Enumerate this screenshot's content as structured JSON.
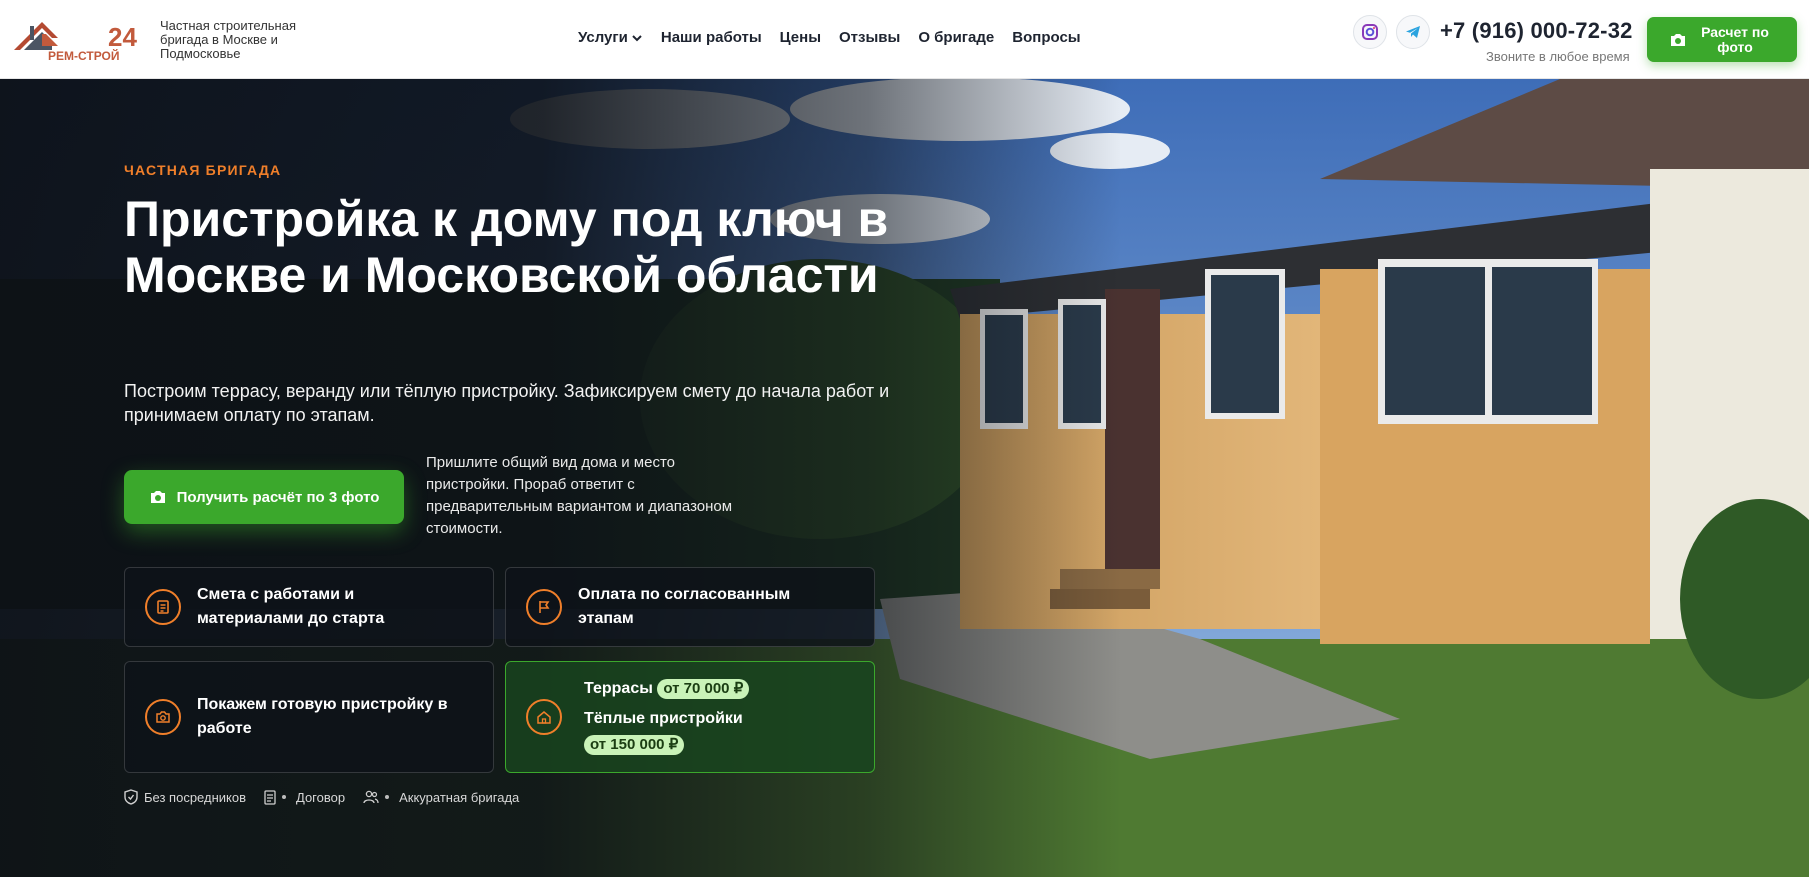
{
  "header": {
    "logo_text": "24 РЕМ-СТРОЙ",
    "tagline": "Частная строительная бригада в Москве и Подмосковье",
    "nav": [
      "Услуги",
      "Наши работы",
      "Цены",
      "Отзывы",
      "О бригаде",
      "Вопросы"
    ],
    "phone": "+7 (916) 000-72-32",
    "phone_note": "Звоните в любое время",
    "button_label": "Расчет по фото",
    "icons": [
      "instagram-icon",
      "telegram-icon",
      "camera-icon"
    ]
  },
  "hero": {
    "eyebrow": "ЧАСТНАЯ БРИГАДА",
    "title": "Пристройка к дому под ключ в Москве и Московской области",
    "subtitle": "Построим террасу, веранду или тёплую пристройку. Зафиксируем смету до начала работ и принимаем оплату по этапам.",
    "cta_label": "Получить расчёт по 3 фото",
    "cta_note": "Пришлите общий вид дома и место пристройки. Прораб ответит с предварительным вариантом и диапазоном стоимости.",
    "cards": [
      {
        "text": "Смета с работами и материалами до старта",
        "icon": "estimate-icon"
      },
      {
        "text": "Оплата по согласованным этапам",
        "icon": "stages-flag-icon"
      },
      {
        "text": "Покажем готовую пристройку в работе",
        "icon": "camera-icon"
      }
    ],
    "price_card": {
      "icon": "house-icon",
      "line1_label": "Террасы",
      "line1_price": "от 70 000 ₽",
      "line2_label": "Тёплые пристройки",
      "line2_price": "от 150 000 ₽"
    },
    "trust": [
      "Без посредников",
      "Договор",
      "Аккуратная бригада"
    ]
  },
  "colors": {
    "accent_green": "#3ba82c",
    "accent_orange": "#f07f2a",
    "dark": "#0c1016"
  }
}
